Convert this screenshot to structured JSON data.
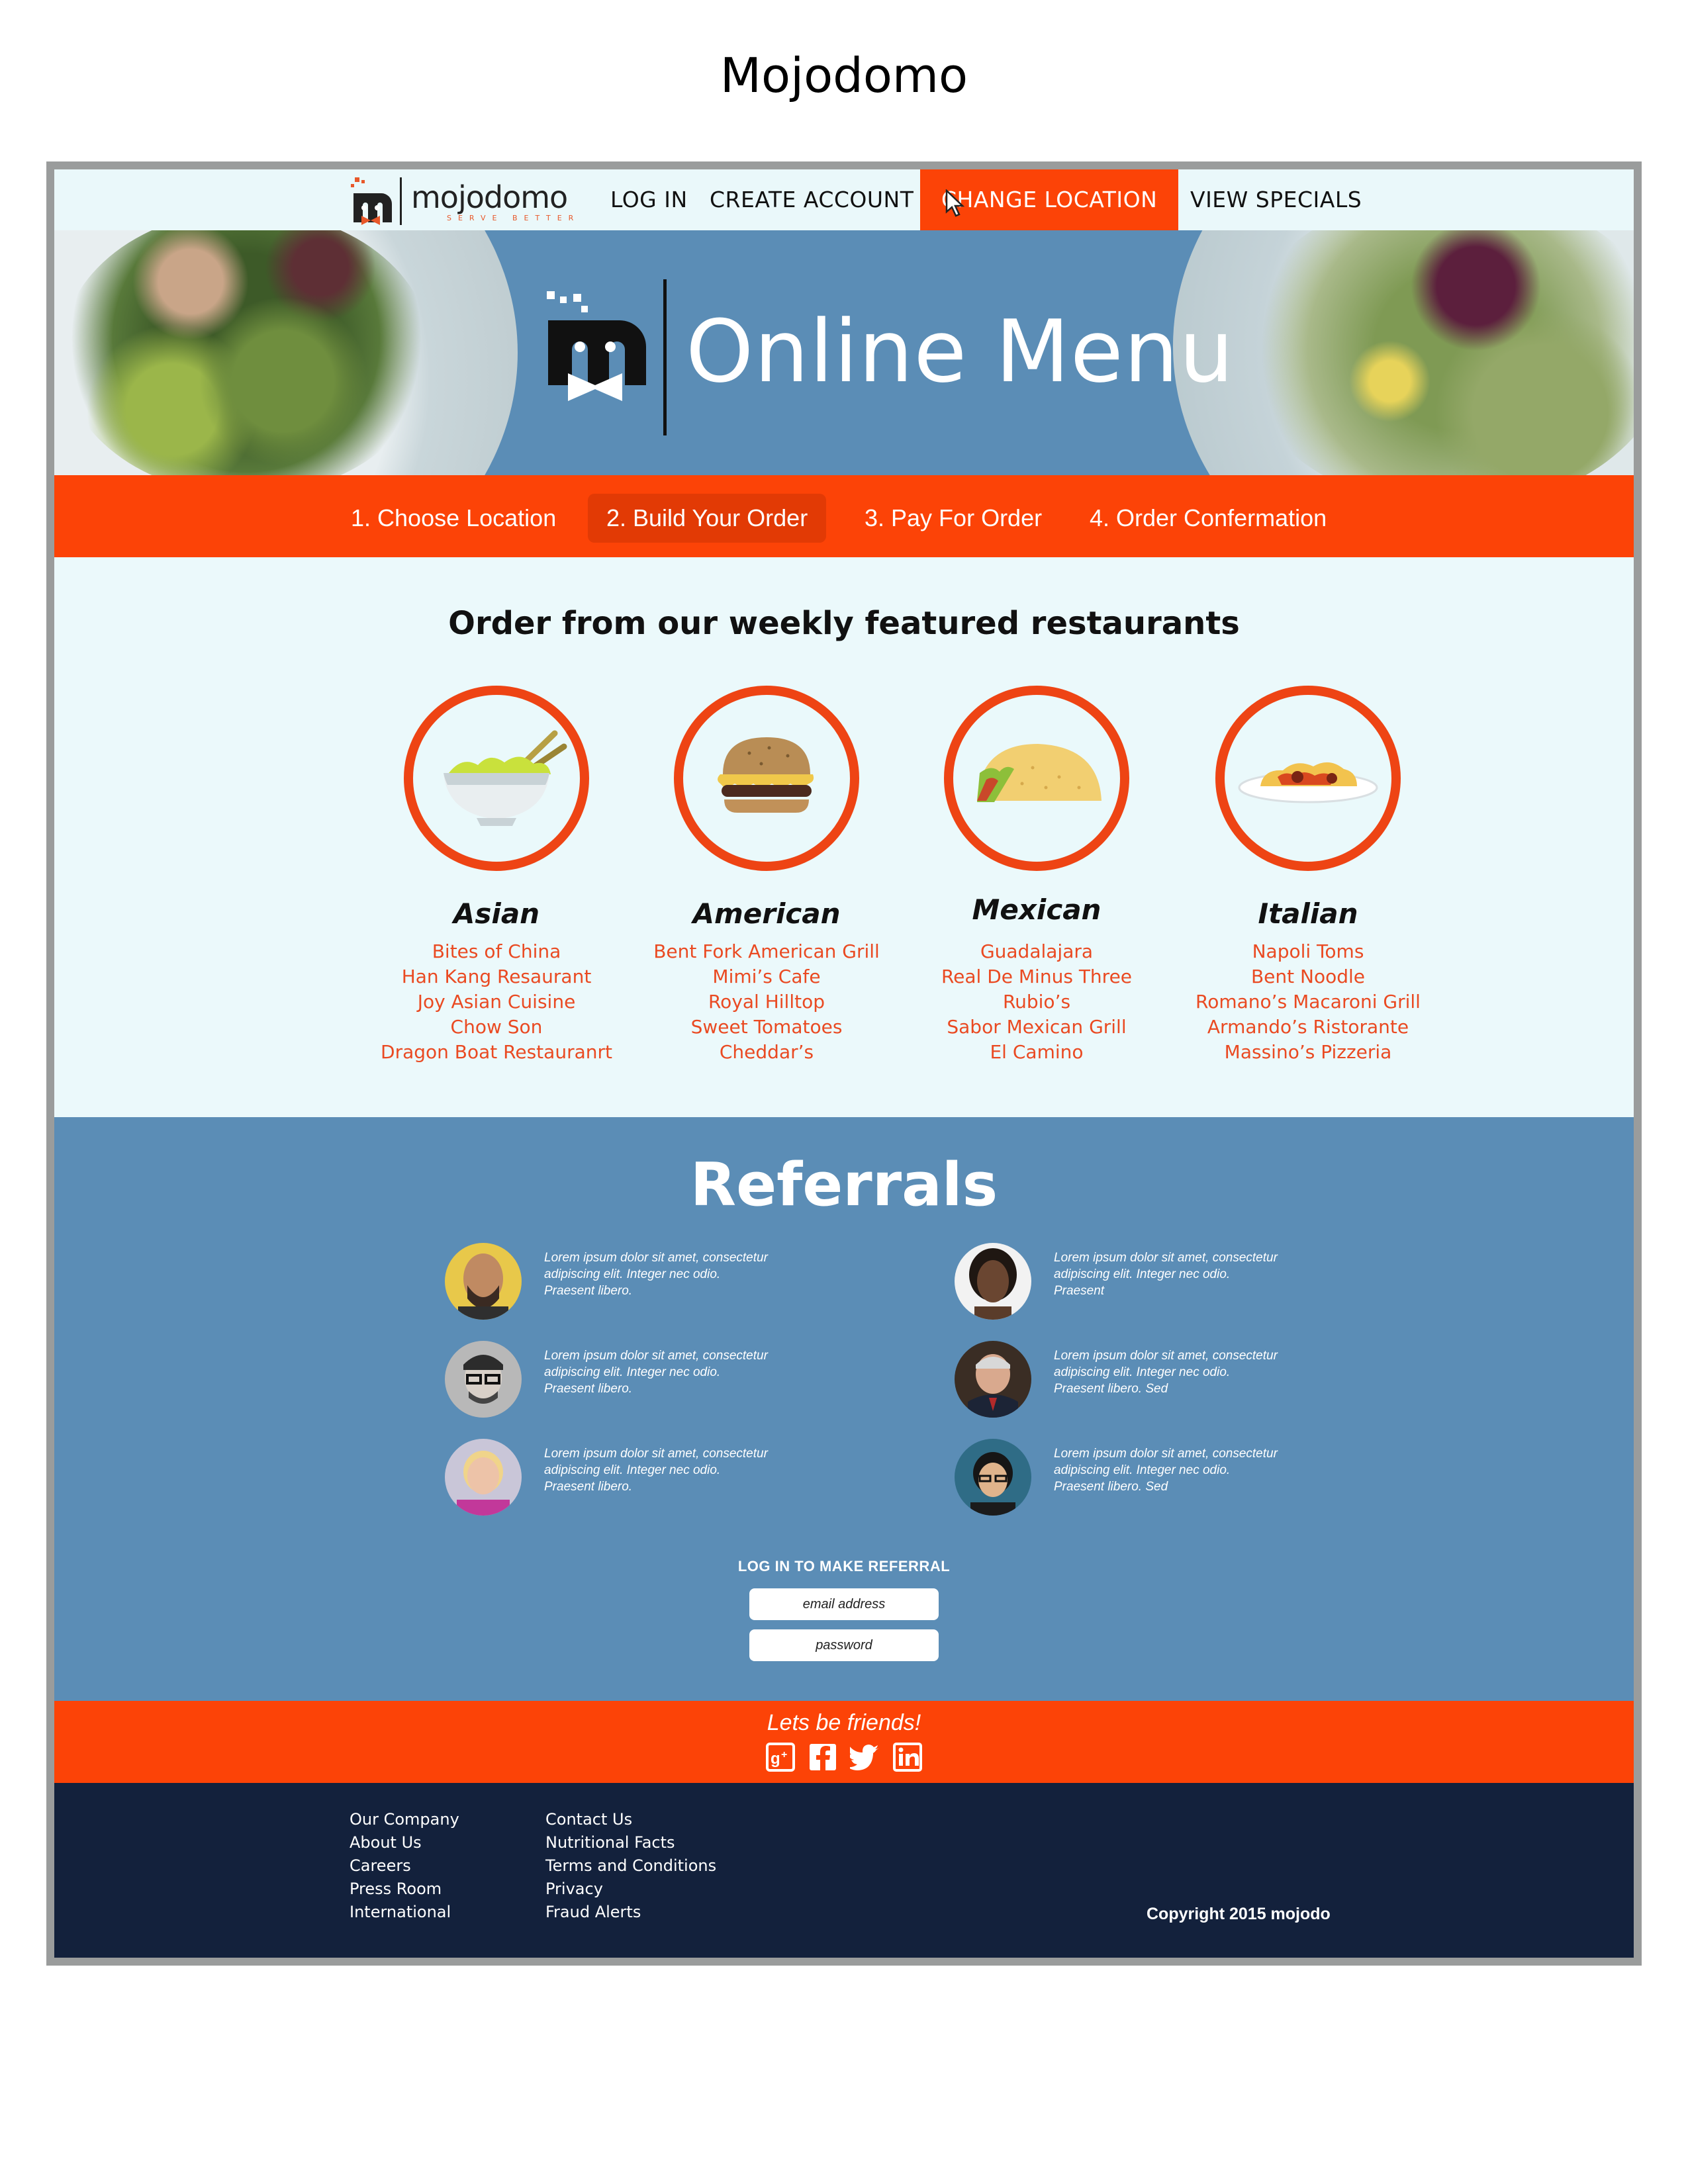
{
  "page_title": "Mojodomo",
  "nav": {
    "logo_word": "mojodomo",
    "logo_tagline": "SERVE BETTER",
    "links": [
      "LOG IN",
      "CREATE ACCOUNT",
      "CHANGE LOCATION",
      "VIEW SPECIALS"
    ],
    "active_link": "CHANGE LOCATION"
  },
  "hero": {
    "title": "Online Menu"
  },
  "steps": [
    "1. Choose Location",
    "2. Build Your Order",
    "3. Pay For Order",
    "4. Order Confermation"
  ],
  "active_step": "2. Build Your Order",
  "featured": {
    "title": "Order from our weekly featured restaurants",
    "cuisines": [
      {
        "name": "Asian",
        "icon": "noodle-bowl-icon",
        "restaurants": [
          "Bites of China",
          "Han Kang Resaurant",
          "Joy Asian Cuisine",
          "Chow Son",
          "Dragon Boat Restauranrt"
        ]
      },
      {
        "name": "American",
        "icon": "burger-icon",
        "restaurants": [
          "Bent Fork American Grill",
          "Mimi’s Cafe",
          "Royal Hilltop",
          "Sweet Tomatoes",
          "Cheddar’s"
        ]
      },
      {
        "name": "Mexican",
        "icon": "taco-icon",
        "restaurants": [
          "Guadalajara",
          "Real De Minus Three",
          "Rubio’s",
          "Sabor Mexican Grill",
          "El Camino"
        ]
      },
      {
        "name": "Italian",
        "icon": "pasta-plate-icon",
        "restaurants": [
          "Napoli Toms",
          "Bent Noodle",
          "Romano’s Macaroni Grill",
          "Armando’s Ristorante",
          "Massino’s Pizzeria"
        ]
      }
    ]
  },
  "referrals": {
    "title": "Referrals",
    "items": [
      {
        "text": "Lorem ipsum dolor sit amet, consectetur adipiscing elit. Integer nec odio. Praesent libero."
      },
      {
        "text": "Lorem ipsum dolor sit amet, consectetur adipiscing elit. Integer nec odio. Praesent libero."
      },
      {
        "text": "Lorem ipsum dolor sit amet, consectetur adipiscing elit. Integer nec odio. Praesent libero."
      },
      {
        "text": "Lorem ipsum dolor sit amet, consectetur adipiscing elit. Integer nec odio. Praesent"
      },
      {
        "text": "Lorem ipsum dolor sit amet, consectetur adipiscing elit. Integer nec odio. Praesent libero. Sed"
      },
      {
        "text": "Lorem ipsum dolor sit amet, consectetur adipiscing elit. Integer nec odio. Praesent libero. Sed"
      }
    ],
    "login_label": "LOG IN TO MAKE REFERRAL",
    "email_placeholder": "email address",
    "password_placeholder": "password"
  },
  "social": {
    "title": "Lets be friends!",
    "icons": [
      "google-plus-icon",
      "facebook-icon",
      "twitter-icon",
      "linkedin-icon"
    ]
  },
  "footer": {
    "col1": [
      "Our Company",
      "About Us",
      "Careers",
      "Press Room",
      "International"
    ],
    "col2": [
      "Contact Us",
      "Nutritional Facts",
      "Terms and Conditions",
      "Privacy",
      "Fraud Alerts"
    ],
    "copyright": "Copyright 2015 mojodo"
  },
  "colors": {
    "accent_orange": "#fc4307",
    "hero_blue": "#5b8db6",
    "footer_navy": "#13213c",
    "page_bg": "#ebf9fb"
  }
}
